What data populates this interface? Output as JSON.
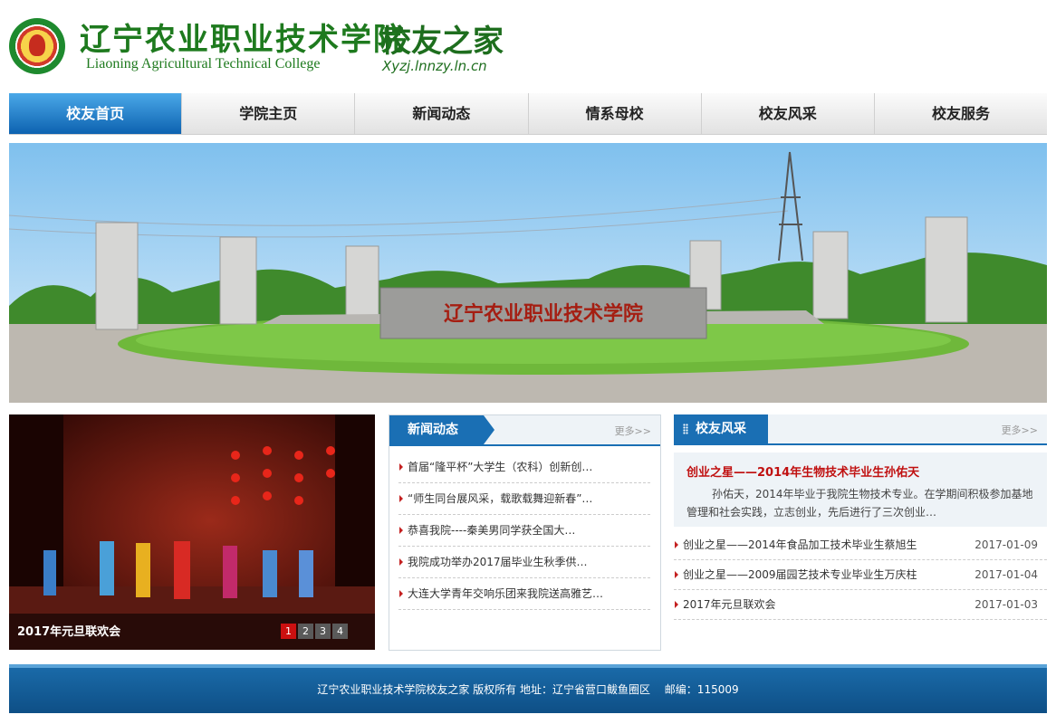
{
  "header": {
    "college_name_cn": "辽宁农业职业技术学院",
    "college_name_en": "Liaoning Agricultural Technical College",
    "site_title": "校友之家",
    "site_domain": "Xyzj.lnnzy.ln.cn"
  },
  "nav": {
    "items": [
      {
        "label": "校友首页",
        "active": true
      },
      {
        "label": "学院主页",
        "active": false
      },
      {
        "label": "新闻动态",
        "active": false
      },
      {
        "label": "情系母校",
        "active": false
      },
      {
        "label": "校友风采",
        "active": false
      },
      {
        "label": "校友服务",
        "active": false
      }
    ]
  },
  "banner": {
    "gate_inscription": "辽宁农业职业技术学院"
  },
  "slideshow": {
    "caption": "2017年元旦联欢会",
    "pages": [
      "1",
      "2",
      "3",
      "4"
    ],
    "active_page": 1
  },
  "news": {
    "title": "新闻动态",
    "more": "更多>>",
    "items": [
      "首届“隆平杯”大学生（农科）创新创…",
      "“师生同台展风采，载歌载舞迎新春”…",
      "恭喜我院----秦美男同学获全国大…",
      "我院成功举办2017届毕业生秋季供…",
      "大连大学青年交响乐团来我院送高雅艺…"
    ]
  },
  "alumni": {
    "title": "校友风采",
    "more": "更多>>",
    "featured_title": "创业之星——2014年生物技术毕业生孙佑天",
    "featured_desc": "孙佑天，2014年毕业于我院生物技术专业。在学期间积极参加基地管理和社会实践，立志创业，先后进行了三次创业…",
    "items": [
      {
        "title": "创业之星——2014年食品加工技术毕业生蔡旭生",
        "date": "2017-01-09"
      },
      {
        "title": "创业之星——2009届园艺技术专业毕业生万庆柱",
        "date": "2017-01-04"
      },
      {
        "title": "2017年元旦联欢会",
        "date": "2017-01-03"
      }
    ]
  },
  "footer": {
    "text": "辽宁农业职业技术学院校友之家 版权所有 地址：辽宁省营口鲅鱼圈区　 邮编：115009"
  },
  "colors": {
    "brand_green": "#1e7a1e",
    "nav_active_blue": "#0d62b0",
    "panel_blue": "#1a6fb4",
    "headline_red": "#c01010"
  }
}
